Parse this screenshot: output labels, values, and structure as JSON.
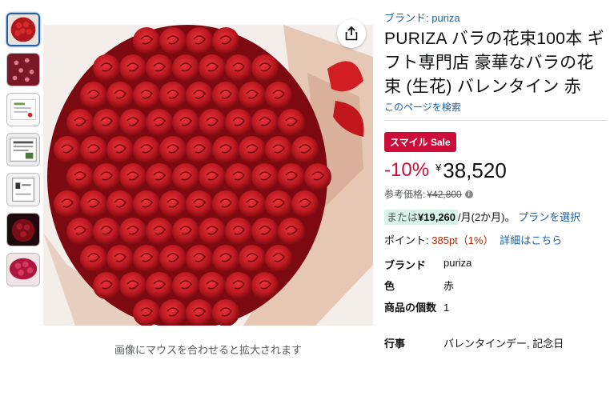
{
  "thumbnails": [
    {
      "name": "thumb-bouquet-red",
      "selected": true
    },
    {
      "name": "thumb-petals"
    },
    {
      "name": "thumb-card"
    },
    {
      "name": "thumb-info"
    },
    {
      "name": "thumb-box"
    },
    {
      "name": "thumb-dark-roses"
    },
    {
      "name": "thumb-pink-roses"
    }
  ],
  "image": {
    "hover_hint": "画像にマウスを合わせると拡大されます",
    "share_icon": "share-icon"
  },
  "product": {
    "brand_link": "ブランド: puriza",
    "title": "PURIZA バラの花束100本 ギフト専門店 豪華なバラの花束 (生花) バレンタイン 赤",
    "search_link": "このページを検索",
    "sale_badge": "スマイル Sale",
    "discount": "-10%",
    "currency": "¥",
    "price": "38,520",
    "ref_label": "参考価格:",
    "ref_price": "¥42,800",
    "install_prefix": "または",
    "install_amount": "¥19,260",
    "install_suffix": "/月(2か月)。",
    "plan_link": "プランを選択",
    "points_label": "ポイント:",
    "points_value": "385pt（1%）",
    "points_link": "詳細はこちら"
  },
  "specs": [
    {
      "key": "ブランド",
      "value": "puriza"
    },
    {
      "key": "色",
      "value": "赤"
    },
    {
      "key": "商品の個数",
      "value": "1"
    },
    {
      "key": "行事",
      "value": "バレンタインデー, 記念日"
    }
  ],
  "colors": {
    "link": "#2162a1",
    "sale": "#cc0c39",
    "points": "#b12704",
    "install_bg": "#d7f3e8"
  }
}
